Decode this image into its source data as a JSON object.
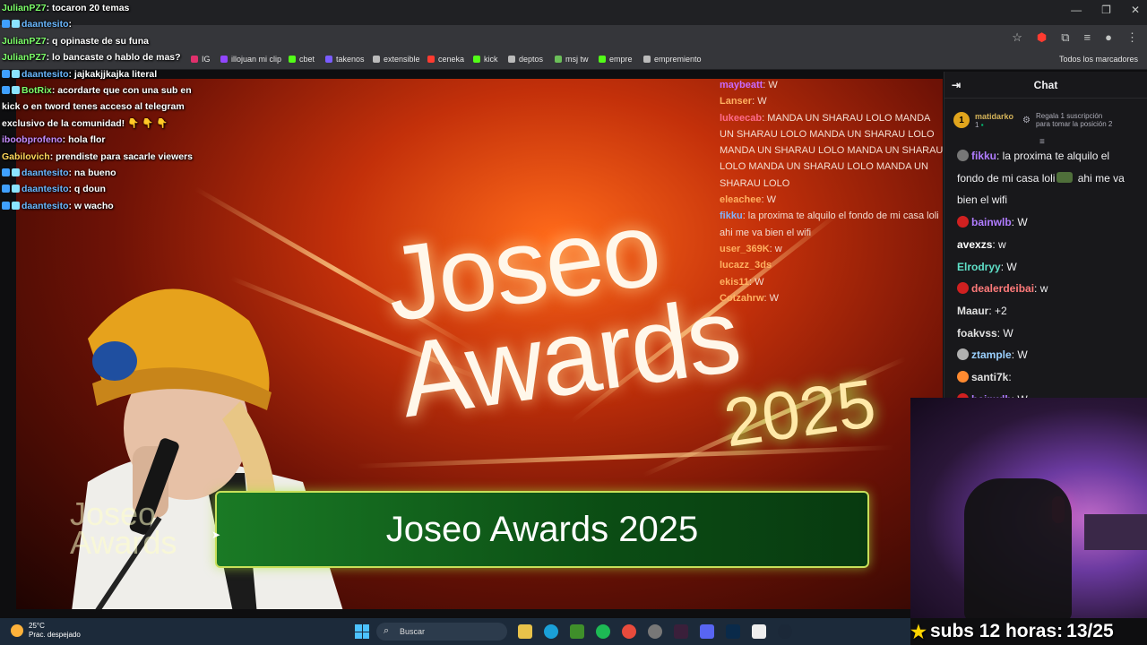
{
  "browser": {
    "bookmarks": [
      {
        "label": "IG",
        "color": "#e1306c"
      },
      {
        "label": "illojuan mi clip",
        "color": "#9146ff"
      },
      {
        "label": "cbet",
        "color": "#53fc18"
      },
      {
        "label": "takenos",
        "color": "#7a5cff"
      },
      {
        "label": "extensible",
        "color": "#bbbbbb"
      },
      {
        "label": "ceneka",
        "color": "#ff3b30"
      },
      {
        "label": "kick",
        "color": "#53fc18"
      },
      {
        "label": "deptos",
        "color": "#bbbbbb"
      },
      {
        "label": "msj tw",
        "color": "#6bbf59"
      },
      {
        "label": "empre",
        "color": "#53fc18"
      },
      {
        "label": "empremiento",
        "color": "#bbbbbb"
      }
    ],
    "all_bookmarks": "Todos los marcadores"
  },
  "overlay_chat": [
    {
      "user": "JulianPZ7",
      "color": "#7dff6a",
      "text": ": tocaron 20 temas",
      "icons": false
    },
    {
      "user": "daantesito",
      "color": "#6ab8ff",
      "text": ":",
      "icons": true
    },
    {
      "user": "JulianPZ7",
      "color": "#7dff6a",
      "text": ": q opinaste de su funa",
      "icons": false
    },
    {
      "user": "JulianPZ7",
      "color": "#7dff6a",
      "text": ": lo bancaste o hablo de mas?",
      "icons": false
    },
    {
      "user": "daantesito",
      "color": "#6ab8ff",
      "text": ": jajkakjjkajka literal",
      "icons": true
    },
    {
      "user": "BotRix",
      "color": "#7dff6a",
      "text": ": acordarte que con una sub en kick o en tword tenes acceso al telegram exclusivo de la comunidad! 👇 👇 👇",
      "icons": true
    },
    {
      "user": "iboobprofeno",
      "color": "#c58cff",
      "text": ": hola flor",
      "icons": false
    },
    {
      "user": "Gabilovich",
      "color": "#ffd75a",
      "text": ": prendiste para sacarle viewers",
      "icons": false
    },
    {
      "user": "daantesito",
      "color": "#6ab8ff",
      "text": ": na bueno",
      "icons": true
    },
    {
      "user": "daantesito",
      "color": "#6ab8ff",
      "text": ": q doun",
      "icons": true
    },
    {
      "user": "daantesito",
      "color": "#6ab8ff",
      "text": ": w wacho",
      "icons": true
    }
  ],
  "video": {
    "logo_line1": "Joseo",
    "logo_line2": "Awards",
    "logo_year": "2025",
    "lower_third": "Joseo Awards 2025",
    "corner_logo_1": "Joseo",
    "corner_logo_2": "Awards"
  },
  "video_chat": [
    {
      "user": "maybeatt",
      "color": "#c86bff",
      "text": ": W"
    },
    {
      "user": "Lanser",
      "color": "#ffb060",
      "text": ": W"
    },
    {
      "user": "lukeecab",
      "color": "#ff6a8a",
      "text": ": MANDA UN SHARAU LOLO MANDA UN SHARAU LOLO MANDA UN SHARAU LOLO MANDA UN SHARAU LOLO MANDA UN SHARAU LOLO MANDA UN SHARAU LOLO MANDA UN SHARAU LOLO"
    },
    {
      "user": "eleachee",
      "color": "#ffb060",
      "text": ": W"
    },
    {
      "user": "fikku",
      "color": "#7fb4ff",
      "text": ": la proxima te alquilo el fondo de mi casa loli ahi me va bien el wifi"
    },
    {
      "user": "user_369K",
      "color": "#ffb060",
      "text": ": w"
    },
    {
      "user": "lucazz_3ds",
      "color": "#ffb060",
      "text": ""
    },
    {
      "user": "ekis11",
      "color": "#ffb060",
      "text": ": W"
    },
    {
      "user": "Cotzahrw",
      "color": "#ffb060",
      "text": ": W"
    }
  ],
  "chat": {
    "title": "Chat",
    "gift": {
      "rank": "1",
      "user": "matidarko",
      "count": "1",
      "text": "Regala 1 suscripción para tomar la posición 2"
    },
    "messages": [
      {
        "user": "fikku",
        "color": "#b07cff",
        "text": ": la proxima te alquilo el fondo de mi casa loli",
        "text2": " ahi me va bien el wifi",
        "badge": "#777777"
      },
      {
        "user": "bainwlb",
        "color": "#b07cff",
        "text": ": W",
        "badge": "#d02020"
      },
      {
        "user": "avexzs",
        "color": "#ffffff",
        "text": ": w",
        "badge": ""
      },
      {
        "user": "Elrodryy",
        "color": "#5fe0c8",
        "text": ": W",
        "badge": ""
      },
      {
        "user": "dealerdeibai",
        "color": "#ff7a7a",
        "text": ": w",
        "badge": "#d02020"
      },
      {
        "user": "Maaur",
        "color": "#e0e0e0",
        "text": ": +2",
        "badge": ""
      },
      {
        "user": "foakvss",
        "color": "#e0e0e0",
        "text": ": W",
        "badge": ""
      },
      {
        "user": "ztample",
        "color": "#9ad0ff",
        "text": ": W",
        "badge": "#b0b0b0"
      },
      {
        "user": "santi7k",
        "color": "#e0e0e0",
        "text": ":",
        "badge": "#ff8a30"
      },
      {
        "user": "bainwlb",
        "color": "#b07cff",
        "text": ": W",
        "badge": "#d02020"
      }
    ]
  },
  "stream": {
    "subs_text": "subs 12 horas:",
    "subs_count": "13/25"
  },
  "taskbar": {
    "temp": "25°C",
    "weather": "Prac. despejado",
    "search": "Buscar"
  }
}
